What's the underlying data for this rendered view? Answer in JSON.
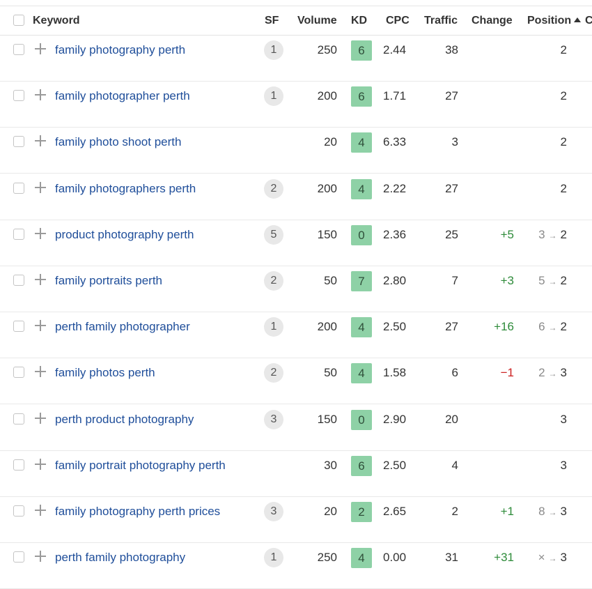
{
  "header": {
    "keyword": "Keyword",
    "sf": "SF",
    "volume": "Volume",
    "kd": "KD",
    "cpc": "CPC",
    "traffic": "Traffic",
    "change": "Change",
    "position": "Position",
    "next_col": "C"
  },
  "colors": {
    "link": "#1f4e9a",
    "kd_green": "#8ed1a6",
    "change_up": "#2e8b3a",
    "change_down": "#cc1f1f"
  },
  "rows": [
    {
      "keyword": "family photography perth",
      "sf": "1",
      "volume": "250",
      "kd": "6",
      "cpc": "2.44",
      "traffic": "38",
      "change": "",
      "change_dir": "",
      "pos_prev": "",
      "pos_arrow": "",
      "position": "2"
    },
    {
      "keyword": "family photographer perth",
      "sf": "1",
      "volume": "200",
      "kd": "6",
      "cpc": "1.71",
      "traffic": "27",
      "change": "",
      "change_dir": "",
      "pos_prev": "",
      "pos_arrow": "",
      "position": "2"
    },
    {
      "keyword": "family photo shoot perth",
      "sf": "",
      "volume": "20",
      "kd": "4",
      "cpc": "6.33",
      "traffic": "3",
      "change": "",
      "change_dir": "",
      "pos_prev": "",
      "pos_arrow": "",
      "position": "2"
    },
    {
      "keyword": "family photographers perth",
      "sf": "2",
      "volume": "200",
      "kd": "4",
      "cpc": "2.22",
      "traffic": "27",
      "change": "",
      "change_dir": "",
      "pos_prev": "",
      "pos_arrow": "",
      "position": "2"
    },
    {
      "keyword": "product photography perth",
      "sf": "5",
      "volume": "150",
      "kd": "0",
      "cpc": "2.36",
      "traffic": "25",
      "change": "+5",
      "change_dir": "up",
      "pos_prev": "3",
      "pos_arrow": "→",
      "position": "2"
    },
    {
      "keyword": "family portraits perth",
      "sf": "2",
      "volume": "50",
      "kd": "7",
      "cpc": "2.80",
      "traffic": "7",
      "change": "+3",
      "change_dir": "up",
      "pos_prev": "5",
      "pos_arrow": "→",
      "position": "2"
    },
    {
      "keyword": "perth family photographer",
      "sf": "1",
      "volume": "200",
      "kd": "4",
      "cpc": "2.50",
      "traffic": "27",
      "change": "+16",
      "change_dir": "up",
      "pos_prev": "6",
      "pos_arrow": "→",
      "position": "2"
    },
    {
      "keyword": "family photos perth",
      "sf": "2",
      "volume": "50",
      "kd": "4",
      "cpc": "1.58",
      "traffic": "6",
      "change": "−1",
      "change_dir": "down",
      "pos_prev": "2",
      "pos_arrow": "→",
      "position": "3"
    },
    {
      "keyword": "perth product photography",
      "sf": "3",
      "volume": "150",
      "kd": "0",
      "cpc": "2.90",
      "traffic": "20",
      "change": "",
      "change_dir": "",
      "pos_prev": "",
      "pos_arrow": "",
      "position": "3"
    },
    {
      "keyword": "family portrait photography perth",
      "sf": "",
      "volume": "30",
      "kd": "6",
      "cpc": "2.50",
      "traffic": "4",
      "change": "",
      "change_dir": "",
      "pos_prev": "",
      "pos_arrow": "",
      "position": "3"
    },
    {
      "keyword": "family photography perth prices",
      "sf": "3",
      "volume": "20",
      "kd": "2",
      "cpc": "2.65",
      "traffic": "2",
      "change": "+1",
      "change_dir": "up",
      "pos_prev": "8",
      "pos_arrow": "→",
      "position": "3"
    },
    {
      "keyword": "perth family photography",
      "sf": "1",
      "volume": "250",
      "kd": "4",
      "cpc": "0.00",
      "traffic": "31",
      "change": "+31",
      "change_dir": "up",
      "pos_prev": "×",
      "pos_arrow": "→",
      "position": "3"
    }
  ]
}
